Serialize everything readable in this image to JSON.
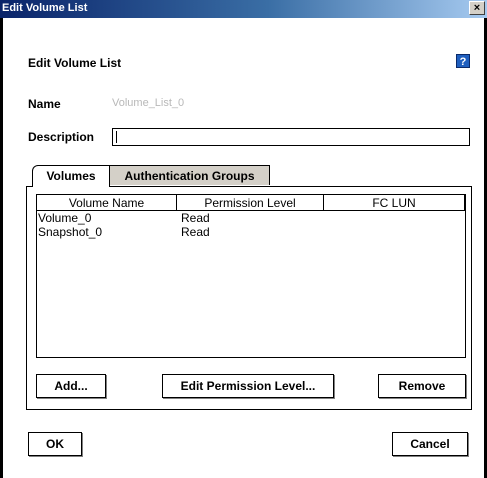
{
  "window": {
    "title": "Edit Volume List",
    "close_glyph": "×"
  },
  "dialog": {
    "heading": "Edit Volume List",
    "help_glyph": "?",
    "name_label": "Name",
    "name_value": "Volume_List_0",
    "description_label": "Description",
    "description_value": ""
  },
  "tabs": [
    {
      "label": "Volumes",
      "active": true
    },
    {
      "label": "Authentication Groups",
      "active": false
    }
  ],
  "table": {
    "columns": [
      "Volume Name",
      "Permission Level",
      "FC LUN"
    ],
    "rows": [
      {
        "name": "Volume_0",
        "permission": "Read",
        "lun": ""
      },
      {
        "name": "Snapshot_0",
        "permission": "Read",
        "lun": ""
      }
    ]
  },
  "buttons": {
    "add": "Add...",
    "edit_permission": "Edit Permission Level...",
    "remove": "Remove",
    "ok": "OK",
    "cancel": "Cancel"
  },
  "colors": {
    "titlebar_start": "#0a246a",
    "titlebar_end": "#a6caf0",
    "help_icon": "#1f5fbf"
  }
}
